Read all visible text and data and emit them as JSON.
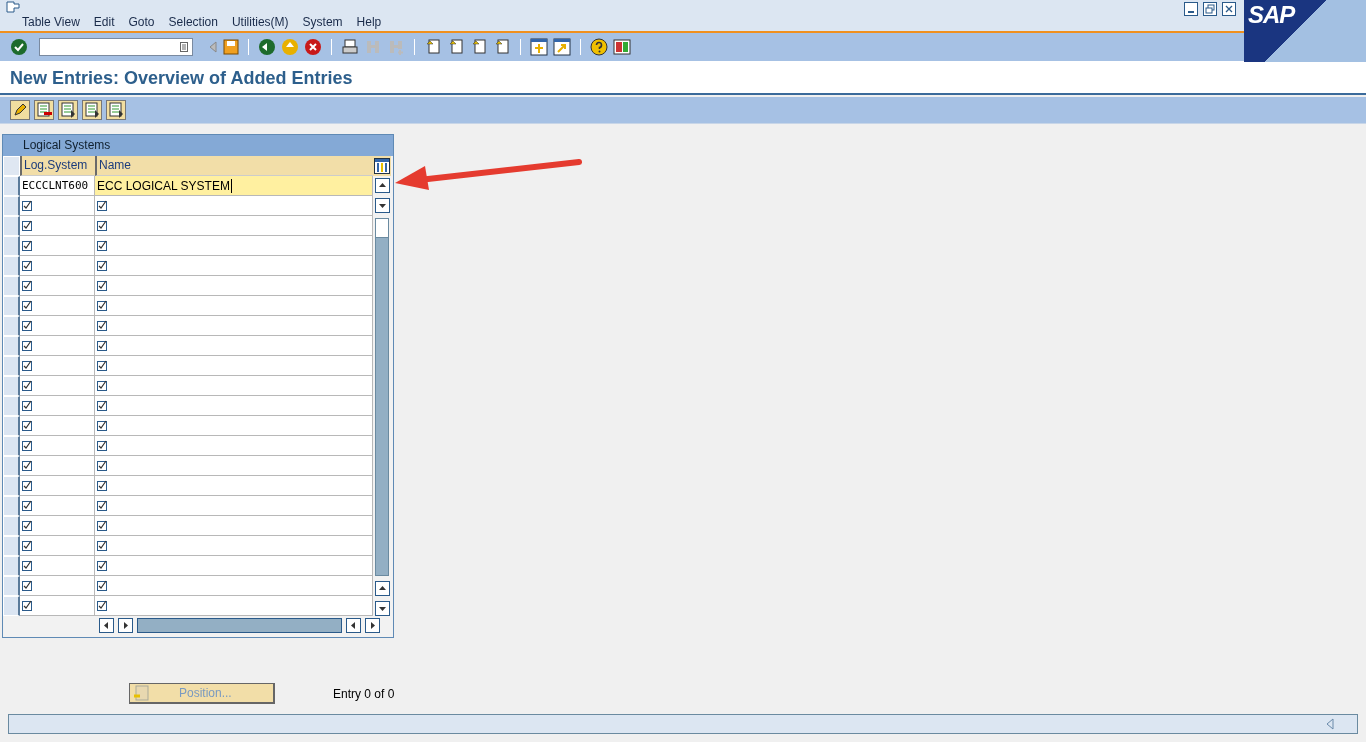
{
  "menu": [
    "Table View",
    "Edit",
    "Goto",
    "Selection",
    "Utilities(M)",
    "System",
    "Help"
  ],
  "logo": "SAP",
  "title": "New Entries: Overview of Added Entries",
  "table": {
    "title": "Logical Systems",
    "columns": [
      "Log.System",
      "Name"
    ],
    "rows": [
      {
        "kind": "entry",
        "cells": [
          "ECCCLNT600",
          "ECC LOGICAL SYSTEM"
        ],
        "focused": true
      },
      {
        "kind": "checkbox"
      },
      {
        "kind": "checkbox"
      },
      {
        "kind": "checkbox"
      },
      {
        "kind": "checkbox"
      },
      {
        "kind": "checkbox"
      },
      {
        "kind": "checkbox"
      },
      {
        "kind": "checkbox"
      },
      {
        "kind": "checkbox"
      },
      {
        "kind": "checkbox"
      },
      {
        "kind": "checkbox"
      },
      {
        "kind": "checkbox"
      },
      {
        "kind": "checkbox"
      },
      {
        "kind": "checkbox"
      },
      {
        "kind": "checkbox"
      },
      {
        "kind": "checkbox"
      },
      {
        "kind": "checkbox"
      },
      {
        "kind": "checkbox"
      },
      {
        "kind": "checkbox"
      },
      {
        "kind": "checkbox"
      },
      {
        "kind": "checkbox"
      },
      {
        "kind": "checkbox"
      }
    ]
  },
  "position_button": {
    "label": "Position...",
    "disabled": true
  },
  "entry_info": "Entry 0 of 0"
}
